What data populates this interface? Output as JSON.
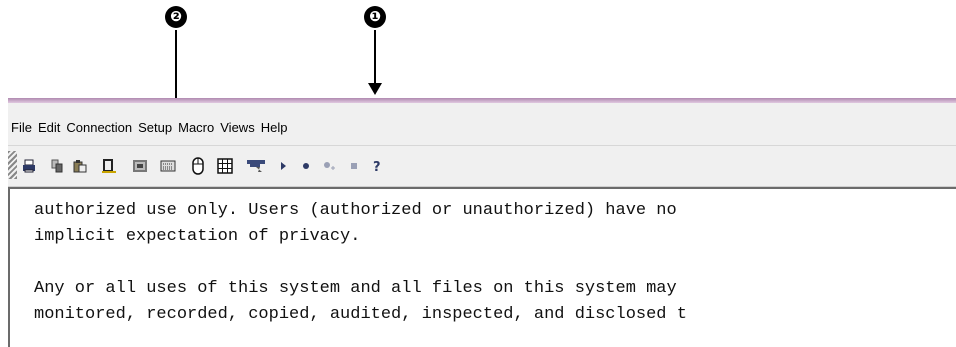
{
  "annotations": {
    "callout_1": "❶",
    "callout_2": "❷"
  },
  "menu": [
    "File",
    "Edit",
    "Connection",
    "Setup",
    "Macro",
    "Views",
    "Help"
  ],
  "toolbar_icons": [
    "print-icon",
    "copy-icon",
    "paste-icon",
    "paste-special-icon",
    "screen-icon",
    "keypad-icon",
    "mouse-icon",
    "grid-icon",
    "transfer-icon",
    "play-macro-icon",
    "record-macro-icon",
    "pause-macro-icon",
    "stop-macro-icon",
    "help-icon"
  ],
  "terminal": {
    "lines": [
      "authorized use only. Users (authorized or unauthorized) have no",
      "implicit expectation of privacy.",
      "",
      "Any or all uses of this system and all files on this system may",
      "monitored, recorded, copied, audited, inspected, and disclosed t"
    ]
  },
  "colors": {
    "title_accent": "#b08ab0",
    "chrome": "#f0f0f0",
    "terminal_bg": "#ffffff"
  }
}
